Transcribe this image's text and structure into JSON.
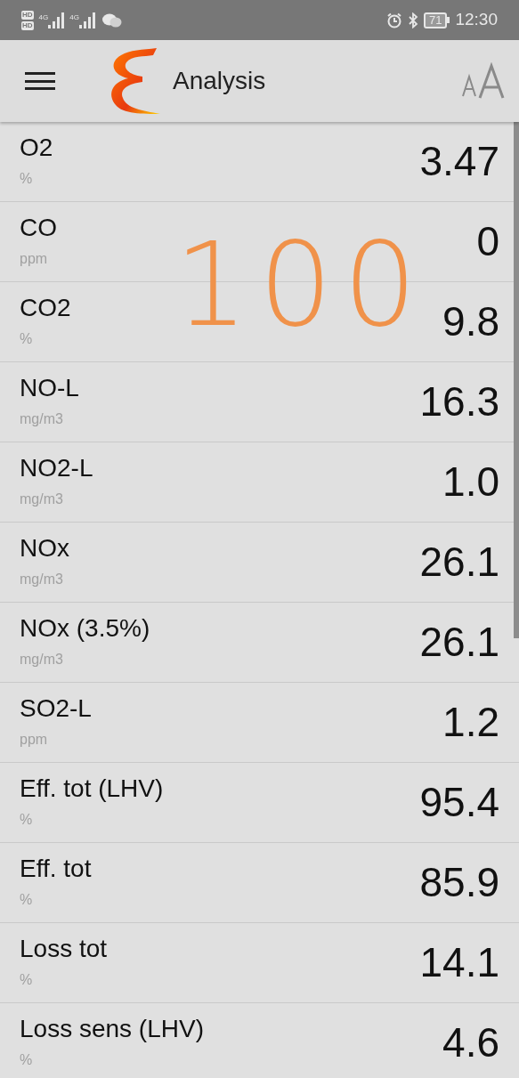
{
  "status_bar": {
    "sim_badges": [
      "HD",
      "HD"
    ],
    "network_labels": [
      "4G",
      "4G"
    ],
    "battery": "71",
    "time": "12:30"
  },
  "app_bar": {
    "title": "Analysis"
  },
  "annotation": "100",
  "rows": [
    {
      "name": "O2",
      "unit": "%",
      "value": "3.47"
    },
    {
      "name": "CO",
      "unit": "ppm",
      "value": "0"
    },
    {
      "name": "CO2",
      "unit": "%",
      "value": "9.8"
    },
    {
      "name": "NO-L",
      "unit": "mg/m3",
      "value": "16.3"
    },
    {
      "name": "NO2-L",
      "unit": "mg/m3",
      "value": "1.0"
    },
    {
      "name": "NOx",
      "unit": "mg/m3",
      "value": "26.1"
    },
    {
      "name": "NOx (3.5%)",
      "unit": "mg/m3",
      "value": "26.1"
    },
    {
      "name": "SO2-L",
      "unit": "ppm",
      "value": "1.2"
    },
    {
      "name": "Eff. tot (LHV)",
      "unit": "%",
      "value": "95.4"
    },
    {
      "name": "Eff. tot",
      "unit": "%",
      "value": "85.9"
    },
    {
      "name": "Loss tot",
      "unit": "%",
      "value": "14.1"
    },
    {
      "name": "Loss sens (LHV)",
      "unit": "%",
      "value": "4.6"
    }
  ]
}
